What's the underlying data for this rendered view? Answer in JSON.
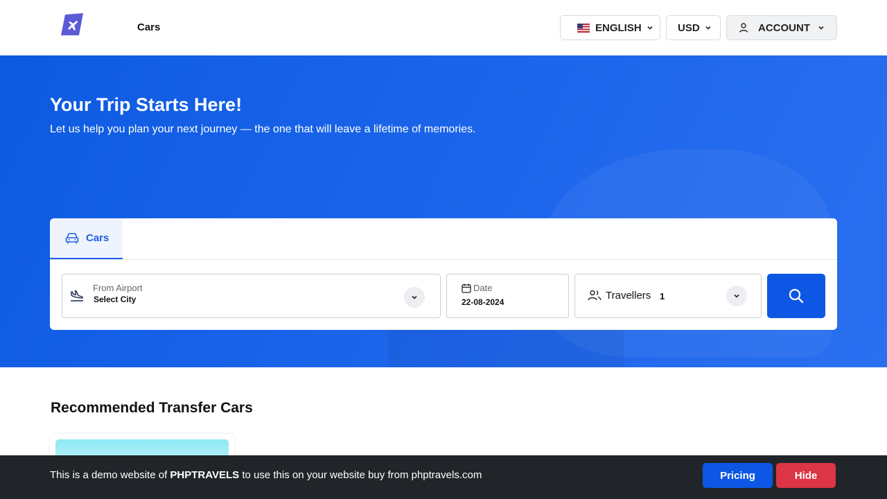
{
  "header": {
    "nav_cars": "Cars",
    "language": "ENGLISH",
    "currency": "USD",
    "account": "ACCOUNT"
  },
  "hero": {
    "title": "Your Trip Starts Here!",
    "subtitle": "Let us help you plan your next journey — the one that will leave a lifetime of memories."
  },
  "search": {
    "tab_label": "Cars",
    "from_label": "From Airport",
    "from_value": "Select City",
    "date_label": "Date",
    "date_value": "22-08-2024",
    "travellers_label": "Travellers",
    "travellers_value": "1"
  },
  "section": {
    "title": "Recommended Transfer Cars"
  },
  "bottom_bar": {
    "text_before": "This is a demo website of ",
    "brand": "PHPTRAVELS",
    "text_after": " to use this on your website buy from phptravels.com",
    "pricing_label": "Pricing",
    "hide_label": "Hide"
  },
  "colors": {
    "primary": "#0d57e4",
    "hero": "#1a64ea",
    "danger": "#dc3545",
    "dark_bar": "#212529"
  },
  "icons": [
    "logo-plane-icon",
    "flag-us-icon",
    "chevron-down-icon",
    "user-icon",
    "car-icon",
    "plane-landing-icon",
    "calendar-icon",
    "users-icon",
    "search-icon"
  ]
}
